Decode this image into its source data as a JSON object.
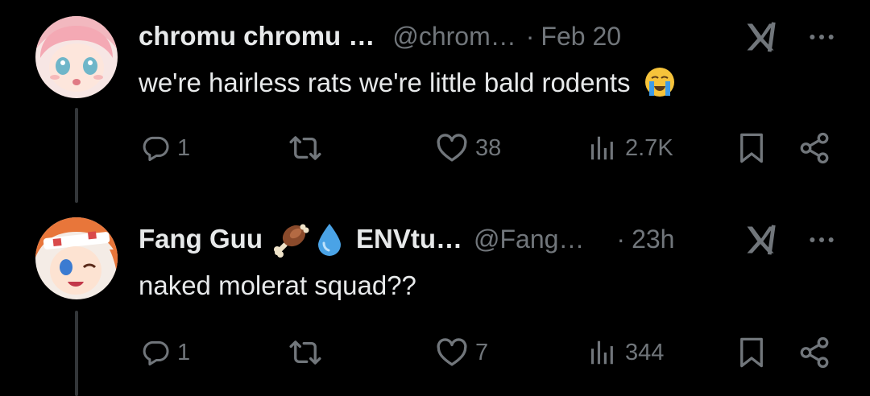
{
  "tweets": [
    {
      "author_name": "chromu chromu …",
      "handle": "@chrom…",
      "separator": "·",
      "time": "Feb 20",
      "text": "we're hairless rats we're little bald rodents",
      "emoji": "loudly-crying-face-emoji",
      "reply_count": "1",
      "like_count": "38",
      "view_count": "2.7K"
    },
    {
      "author_name": "Fang Guu",
      "name_emoji_1": "meat-on-bone-emoji",
      "name_emoji_2": "droplet-emoji",
      "author_name_suffix": "ENVtu…",
      "handle": "@Fang…",
      "separator": "·",
      "time": "23h",
      "text": "naked molerat squad??",
      "reply_count": "1",
      "like_count": "7",
      "view_count": "344"
    }
  ],
  "colors": {
    "background": "#000000",
    "text": "#e7e9ea",
    "muted": "#71767b",
    "thread": "#333639"
  }
}
